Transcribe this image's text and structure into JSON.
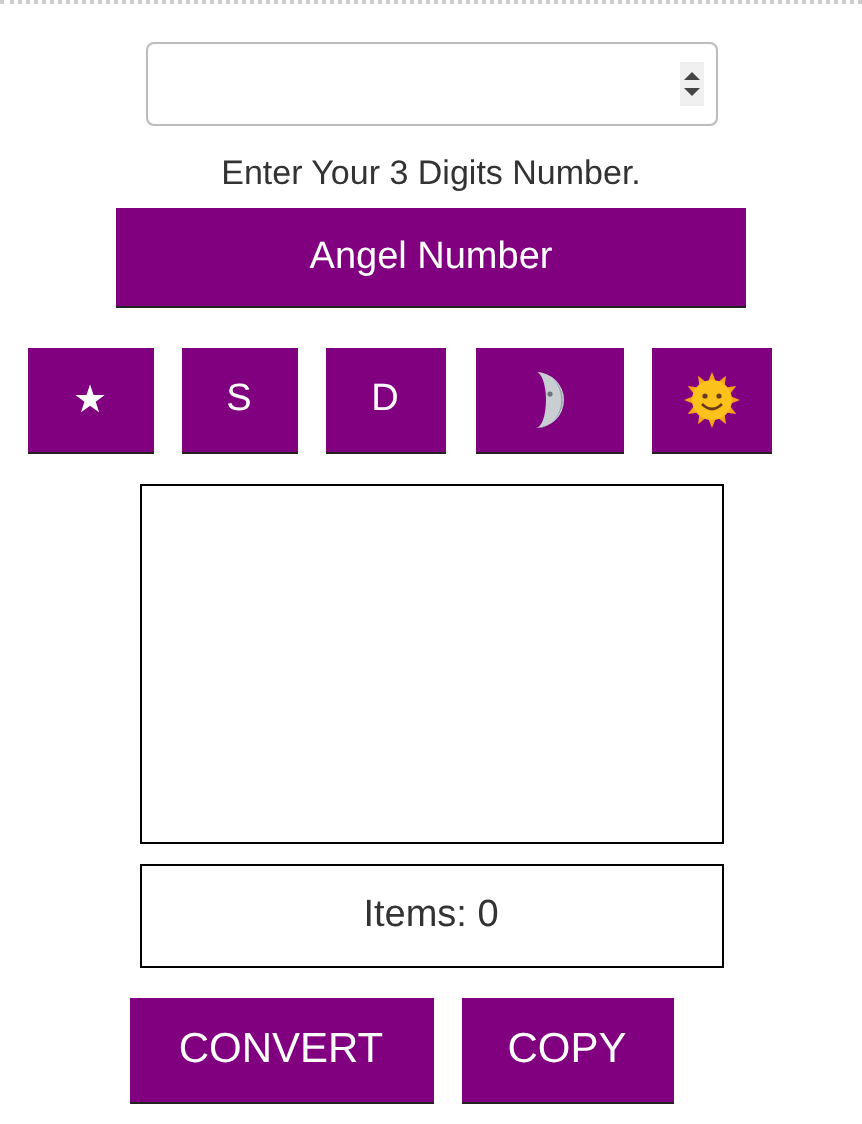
{
  "hint": "Enter Your 3 Digits Number.",
  "main_button": "Angel Number",
  "style_buttons": [
    {
      "kind": "text",
      "label": "★"
    },
    {
      "kind": "text",
      "label": "S"
    },
    {
      "kind": "text",
      "label": "D"
    },
    {
      "kind": "moon"
    },
    {
      "kind": "sun"
    }
  ],
  "counter": "Items: 0",
  "actions": [
    "CONVERT",
    "COPY"
  ]
}
